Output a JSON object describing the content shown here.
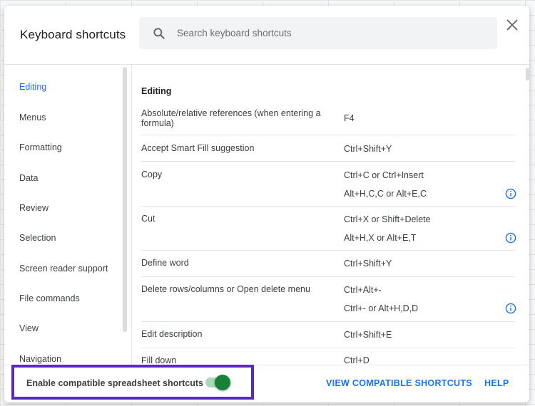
{
  "dialog": {
    "title": "Keyboard shortcuts",
    "search": {
      "placeholder": "Search keyboard shortcuts",
      "value": ""
    }
  },
  "sidebar": {
    "items": [
      {
        "label": "Editing",
        "active": true
      },
      {
        "label": "Menus"
      },
      {
        "label": "Formatting"
      },
      {
        "label": "Data"
      },
      {
        "label": "Review"
      },
      {
        "label": "Selection"
      },
      {
        "label": "Screen reader support"
      },
      {
        "label": "File commands"
      },
      {
        "label": "View"
      },
      {
        "label": "Navigation"
      }
    ]
  },
  "content": {
    "section_title": "Editing",
    "shortcuts": [
      {
        "action": "Absolute/relative references (when entering a formula)",
        "keys": [
          "F4"
        ]
      },
      {
        "action": "Accept Smart Fill suggestion",
        "keys": [
          "Ctrl+Shift+Y"
        ]
      },
      {
        "action": "Copy",
        "keys": [
          "Ctrl+C or Ctrl+Insert",
          "Alt+H,C,C or Alt+E,C"
        ]
      },
      {
        "action": "Cut",
        "keys": [
          "Ctrl+X or Shift+Delete",
          "Alt+H,X or Alt+E,T"
        ]
      },
      {
        "action": "Define word",
        "keys": [
          "Ctrl+Shift+Y"
        ]
      },
      {
        "action": "Delete rows/columns or Open delete menu",
        "keys": [
          "Ctrl+Alt+-",
          "Ctrl+- or Alt+H,D,D"
        ]
      },
      {
        "action": "Edit description",
        "keys": [
          "Ctrl+Shift+E"
        ]
      },
      {
        "action": "Fill down",
        "keys": [
          "Ctrl+D"
        ]
      }
    ]
  },
  "footer": {
    "toggle_label": "Enable compatible spreadsheet shortcuts",
    "toggle_on": true,
    "view_compatible_label": "VIEW COMPATIBLE SHORTCUTS",
    "help_label": "HELP"
  },
  "colors": {
    "accent": "#1a73e8",
    "toggle_knob": "#188038",
    "toggle_track": "#a8dab5",
    "highlight": "#5b2ab8"
  },
  "icons": {
    "search": "search-icon",
    "close": "close-icon",
    "info": "info-icon"
  }
}
